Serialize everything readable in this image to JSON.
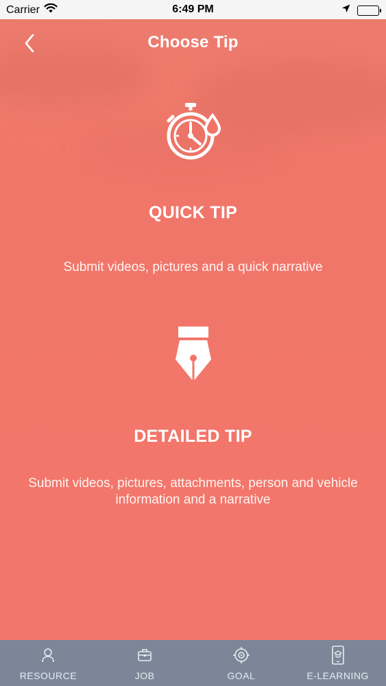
{
  "status_bar": {
    "carrier": "Carrier",
    "time": "6:49 PM"
  },
  "header": {
    "title": "Choose Tip",
    "back_icon": "chevron-left-icon"
  },
  "options": [
    {
      "icon": "stopwatch-drop-icon",
      "title": "QUICK TIP",
      "description": "Submit videos, pictures and a quick narrative"
    },
    {
      "icon": "fountain-pen-nib-icon",
      "title": "DETAILED TIP",
      "description": "Submit videos, pictures, attachments, person and vehicle information and a narrative"
    }
  ],
  "tab_bar": {
    "tabs": [
      {
        "label": "RESOURCE",
        "icon": "person-icon"
      },
      {
        "label": "JOB",
        "icon": "briefcase-icon"
      },
      {
        "label": "GOAL",
        "icon": "target-icon"
      },
      {
        "label": "E-LEARNING",
        "icon": "tablet-graduation-icon"
      }
    ]
  },
  "colors": {
    "background": "#f27468",
    "tab_bar": "#7b8799",
    "text": "#ffffff"
  }
}
